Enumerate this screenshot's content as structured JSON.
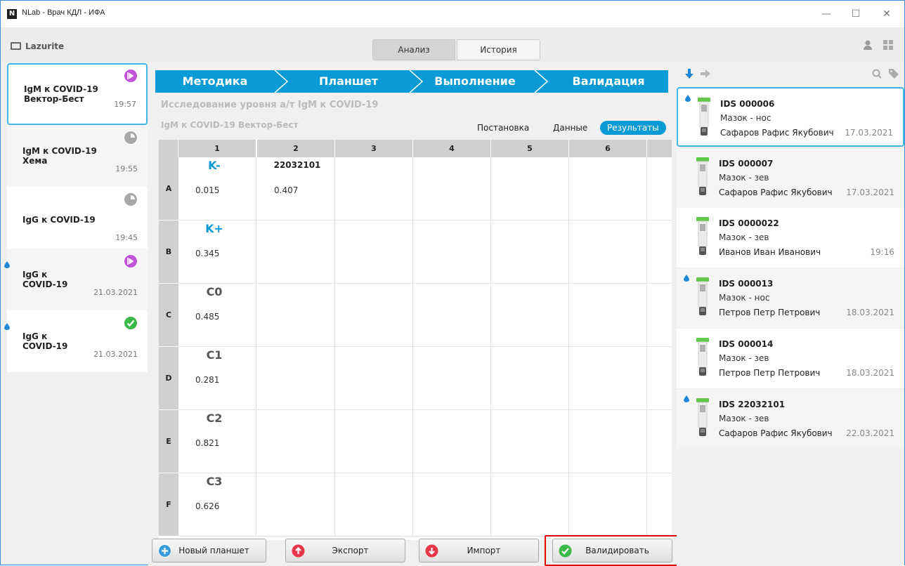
{
  "window": {
    "title": "NLab - Врач КДЛ - ИФА",
    "logo": "N",
    "minimize": "—",
    "maximize": "☐",
    "close": "✕"
  },
  "toolbar": {
    "brand": "Lazurite",
    "tabs": [
      {
        "label": "Анализ",
        "active": true
      },
      {
        "label": "История",
        "active": false
      }
    ]
  },
  "left_items": [
    {
      "title1": "IgM к COVID-19",
      "title2": "Вектор-Бест",
      "time": "19:57",
      "status": "play",
      "drop": false,
      "selected": true
    },
    {
      "title1": "IgM к COVID-19",
      "title2": "Хема",
      "time": "19:55",
      "status": "clock",
      "drop": false
    },
    {
      "title1": "IgG к COVID-19",
      "title2": "",
      "time": "19:45",
      "status": "clock",
      "drop": false
    },
    {
      "title1": "IgG к",
      "title2": "COVID-19",
      "time": "21.03.2021",
      "status": "play",
      "drop": true
    },
    {
      "title1": "IgG к",
      "title2": "COVID-19",
      "time": "21.03.2021",
      "status": "done",
      "drop": true
    }
  ],
  "steps": [
    "Методика",
    "Планшет",
    "Выполнение",
    "Валидация"
  ],
  "study_title": "Исследование уровня а/т IgM к COVID-19",
  "kit_name": "IgM к COVID-19 Вектор-Бест",
  "view_tabs": [
    "Постановка",
    "Данные",
    "Результаты"
  ],
  "plate": {
    "columns": [
      "1",
      "2",
      "3",
      "4",
      "5",
      "6"
    ],
    "rows": [
      "A",
      "B",
      "C",
      "D",
      "E",
      "F"
    ],
    "cells": [
      {
        "r": 0,
        "c": 0,
        "title": "K-",
        "value": "0.015",
        "kind": "control"
      },
      {
        "r": 0,
        "c": 1,
        "title": "22032101",
        "value": "0.407",
        "kind": "sample"
      },
      {
        "r": 1,
        "c": 0,
        "title": "K+",
        "value": "0.345",
        "kind": "control"
      },
      {
        "r": 2,
        "c": 0,
        "title": "C0",
        "value": "0.485",
        "kind": "std"
      },
      {
        "r": 3,
        "c": 0,
        "title": "C1",
        "value": "0.281",
        "kind": "std"
      },
      {
        "r": 4,
        "c": 0,
        "title": "C2",
        "value": "0.821",
        "kind": "std"
      },
      {
        "r": 5,
        "c": 0,
        "title": "C3",
        "value": "0.626",
        "kind": "std"
      }
    ]
  },
  "buttons": {
    "new_plate": "Новый планшет",
    "export": "Экспорт",
    "import": "Импорт",
    "validate": "Валидировать"
  },
  "samples": [
    {
      "id": "IDS 000006",
      "material": "Мазок - нос",
      "patient": "Сафаров Рафис Якубович",
      "date": "17.03.2021",
      "drop": true,
      "selected": true
    },
    {
      "id": "IDS 000007",
      "material": "Мазок - зев",
      "patient": "Сафаров Рафис Якубович",
      "date": "17.03.2021",
      "drop": false
    },
    {
      "id": "IDS 0000022",
      "material": "Мазок - зев",
      "patient": "Иванов Иван Иванович",
      "date": "19:16",
      "drop": false
    },
    {
      "id": "IDS 000013",
      "material": "Мазок - нос",
      "patient": "Петров Петр Петрович",
      "date": "18.03.2021",
      "drop": true
    },
    {
      "id": "IDS 000014",
      "material": "Мазок - зев",
      "patient": "Петров Петр Петрович",
      "date": "18.03.2021",
      "drop": false
    },
    {
      "id": "IDS 22032101",
      "material": "Мазок - зев",
      "patient": "Сафаров Рафис Якубович",
      "date": "22.03.2021",
      "drop": true
    }
  ],
  "colors": {
    "accent": "#0a9ad6",
    "select_border": "#3eb7e4",
    "play": "#c054d6",
    "done": "#3db84a",
    "clock": "#a8a8a8",
    "up": "#e8364a",
    "add": "#3a9ddb",
    "highlight": "#e00000"
  }
}
